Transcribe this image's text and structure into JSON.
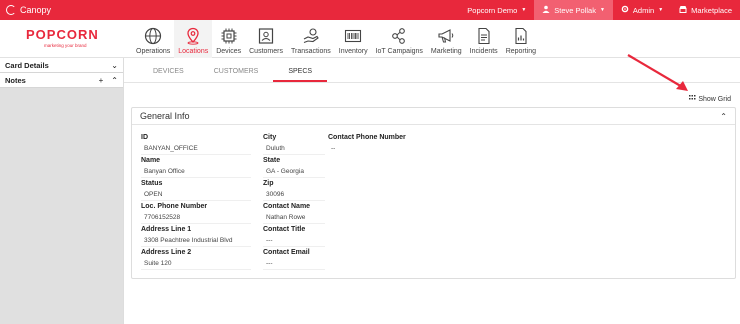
{
  "topbar": {
    "brand": "Canopy",
    "items": [
      {
        "label": "Popcorn Demo"
      },
      {
        "label": "Steve Pollak"
      },
      {
        "label": "Admin"
      },
      {
        "label": "Marketplace"
      }
    ]
  },
  "logo": {
    "name": "POPCORN",
    "tagline": "marketing your brand"
  },
  "modules": [
    {
      "label": "Operations",
      "icon": "globe-icon"
    },
    {
      "label": "Locations",
      "icon": "location-pin-icon"
    },
    {
      "label": "Devices",
      "icon": "chip-icon"
    },
    {
      "label": "Customers",
      "icon": "contact-card-icon"
    },
    {
      "label": "Transactions",
      "icon": "hand-coin-icon"
    },
    {
      "label": "Inventory",
      "icon": "barcode-icon"
    },
    {
      "label": "IoT Campaigns",
      "icon": "network-icon"
    },
    {
      "label": "Marketing",
      "icon": "megaphone-icon"
    },
    {
      "label": "Incidents",
      "icon": "document-icon"
    },
    {
      "label": "Reporting",
      "icon": "report-icon"
    }
  ],
  "sidebar": {
    "card_details": "Card Details",
    "notes": "Notes"
  },
  "tabs": [
    {
      "label": "DEVICES"
    },
    {
      "label": "CUSTOMERS"
    },
    {
      "label": "SPECS"
    }
  ],
  "show_grid": "Show Grid",
  "card": {
    "title": "General Info",
    "col1": [
      {
        "label": "ID",
        "value": "BANYAN_OFFICE"
      },
      {
        "label": "Name",
        "value": "Banyan Office"
      },
      {
        "label": "Status",
        "value": "OPEN"
      },
      {
        "label": "Loc. Phone Number",
        "value": "7706152528"
      },
      {
        "label": "Address Line 1",
        "value": "3308 Peachtree Industrial Blvd"
      },
      {
        "label": "Address Line 2",
        "value": "Suite 120"
      }
    ],
    "col2": [
      {
        "label": "City",
        "value": "Duluth"
      },
      {
        "label": "State",
        "value": "GA - Georgia"
      },
      {
        "label": "Zip",
        "value": "30096"
      },
      {
        "label": "Contact Name",
        "value": "Nathan Rowe"
      },
      {
        "label": "Contact Title",
        "value": "---"
      },
      {
        "label": "Contact Email",
        "value": "---"
      }
    ],
    "col3": [
      {
        "label": "Contact Phone Number",
        "value": "--"
      }
    ]
  },
  "colors": {
    "brand": "#e8283c",
    "topbar_active": "#f26071"
  }
}
